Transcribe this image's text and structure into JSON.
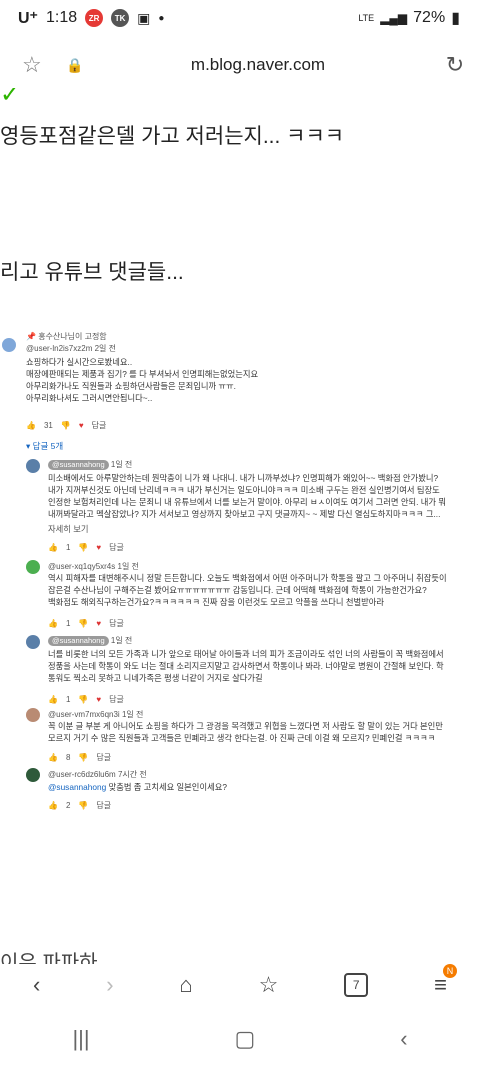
{
  "status": {
    "carrier": "U⁺",
    "time": "1:18",
    "network": "LTE",
    "battery": "72%"
  },
  "browser": {
    "url": "m.blog.naver.com"
  },
  "article": {
    "line1": "영등포점같은델 가고 저러는지... ㅋㅋㅋ",
    "line2": "리고 유튜브 댓글들...",
    "bottom_cut": "이유 파파하"
  },
  "youtube": {
    "top_comment": {
      "pinned": "홍수산나님이 고정함",
      "user": "@user-ln2is7xz2m 2일 전",
      "lines": [
        "쇼핑하다가 실시간으로봤네요..",
        "매장에판매되는 제품과 집기? 를 다 부셔놔서 인명피해는없었는지요",
        "아무리화가나도 직원들과 쇼핑하던사람들은 문죄입니까 ㅠㅠ.",
        "아무리화나셔도 그러시면안됩니다~.."
      ],
      "likes": "31",
      "reply_label": "답글",
      "replies_toggle": "답글 5개"
    },
    "replies": [
      {
        "user": "@susannahong",
        "time": "1일 전",
        "lines": [
          "미소배에서도 아루말안하는데 뭔막충이 니가 왜 나대니. 내가 니까부셨냐? 인명피해가 왜있어~~ 백화점 안가봤니?",
          "내가 지꺼부신것도 아닌데 난리네ㅋㅋㅋ 내가 부신거는 일도아니야ㅋㅋㅋ 미소배 구두는 완전 실인병기여서 팀장도",
          "인정한 보험처리인데 나는 문죄니 내 유튜브에서 너를 보는거 말이야. 아무리 ㅂㅅ이여도 여기서 그러면 안되. 내가 뭐",
          "내꺼봐달라고 멕살잡았나? 지가 서서보고 영상까지 찾아보고 구지 댓글까지~ ~ 제발 다신 열심도하지마ㅋㅋㅋ 그..."
        ],
        "more": "자세히 보기",
        "likes": "1",
        "reply_label": "답글"
      },
      {
        "user": "@user-xq1qy5xr4s",
        "time": "1일 전",
        "lines": [
          "역시 피해자를 대변해주시니 정말 든든합니다. 오늘도 백화점에서 어떤 아주머니가 학통을 팔고 그 아주머니 취잡듯이",
          "잡은걸 수산나님이 구해주는걸 봤어요ㅠㅠㅠㅠㅠㅠㅠ 감동입니다. 근데 어떡해 백화점에 학통이 가능한건가요?",
          "백화점도 해외직구하는건가요?ㅋㅋㅋㅋㅋㅋ 진짜 잠을 이런것도 모르고 악플을 쓰다니 천벌받아라"
        ],
        "likes": "1",
        "reply_label": "답글"
      },
      {
        "user": "@susannahong",
        "time": "1일 전",
        "lines": [
          "너를 비롯한 너의 모든 가족과 니가 앞으로 태어날 아이들과 너의 피가 조금이라도 섞인 너의 사람들이 꼭 백화점에서",
          "정품을 사는데 학통이 와도 너는 절대 소리지르지말고 감사하면서 학통이나 봐라. 너야말로 병원이 간절해 보인다. 학",
          "통워도 찍소리 못하고 니네가족은 평생 너같이 거지로 살다가길"
        ],
        "likes": "1",
        "reply_label": "답글"
      },
      {
        "user": "@user-vm7mx6qn3i",
        "time": "1일 전",
        "lines": [
          "꼭 이분 글 부분 게 아니어도 쇼핑을 하다가 그 광경을 목격했고 위협을 느꼈다면 저 사람도 할 말이 있는 거다 본인만",
          "모르지 거기 수 많은 직원들과 고객들은 민폐라고 생각 한다는걸. 아 진짜 근데 이걸 왜 모르지? 민폐인걸 ㅋㅋㅋㅋ"
        ],
        "likes": "8",
        "reply_label": "답글"
      },
      {
        "user": "@user-rc6dz6lu6m",
        "time": "7시간 전",
        "mention": "@susannahong",
        "lines": [
          "맞춤법 좀 고치세요 일본인이세요?"
        ],
        "likes": "2",
        "reply_label": "답글"
      }
    ]
  },
  "bottom_nav": {
    "tabs_count": "7",
    "notif_badge": "N"
  },
  "icons": [
    "star-icon",
    "lock-icon",
    "reload-icon",
    "back-icon",
    "forward-icon",
    "home-icon",
    "bookmark-icon",
    "tabs-icon",
    "menu-icon",
    "thumb-up-icon",
    "thumb-down-icon"
  ]
}
